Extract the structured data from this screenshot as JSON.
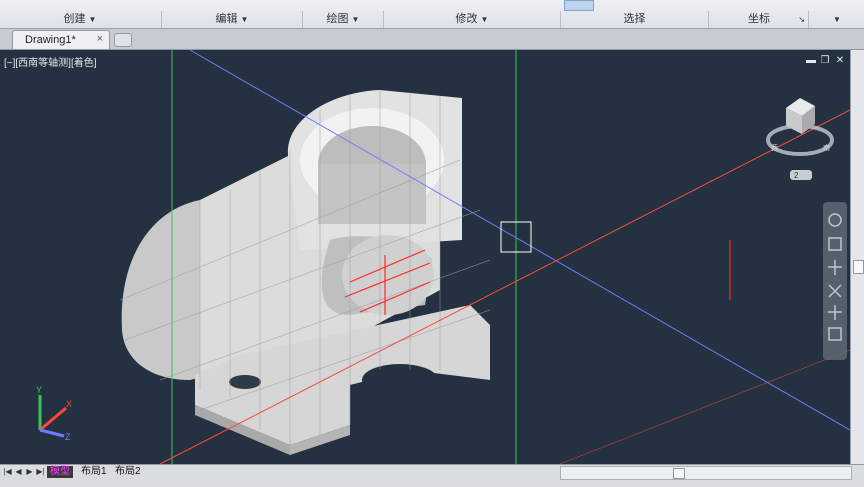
{
  "ribbon": {
    "panels": [
      {
        "label": "创建"
      },
      {
        "label": "编辑"
      },
      {
        "label": "绘图"
      },
      {
        "label": "修改"
      },
      {
        "label": "选择"
      },
      {
        "label": "坐标"
      }
    ]
  },
  "tabs": {
    "document": "Drawing1*",
    "close_glyph": "×"
  },
  "viewport": {
    "label": "[−][西南等轴测][着色]",
    "viewcube_badge": "2"
  },
  "layout_tabs": [
    "模型",
    "布局1",
    "布局2"
  ],
  "colors": {
    "canvas": "#243140",
    "x_axis": "#ff4a3a",
    "y_axis": "#3ec45a",
    "z_axis": "#6d7cff",
    "solid": "#d8d8d8"
  },
  "icons": [
    "minimize-icon",
    "restore-icon",
    "close-icon",
    "viewcube-icon",
    "ucs-icon",
    "navbar-icon"
  ]
}
